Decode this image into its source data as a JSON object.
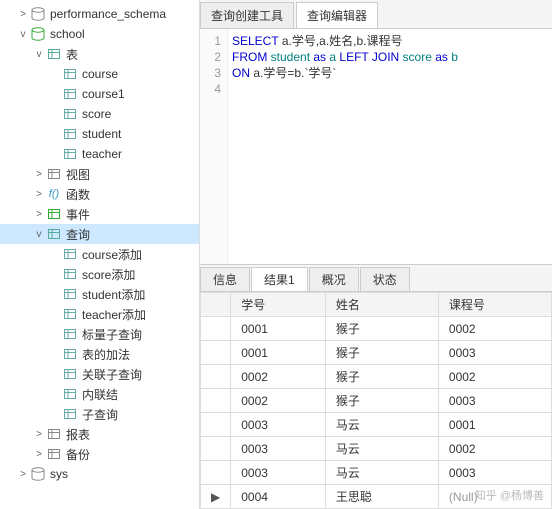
{
  "sidebar": {
    "nodes": [
      {
        "indent": 1,
        "expander": ">",
        "icon": "db",
        "label": "performance_schema",
        "name": "db-performance-schema",
        "interact": true
      },
      {
        "indent": 1,
        "expander": "v",
        "icon": "db-green",
        "label": "school",
        "name": "db-school",
        "interact": true
      },
      {
        "indent": 2,
        "expander": "v",
        "icon": "folder-table",
        "label": "表",
        "name": "folder-tables",
        "interact": true
      },
      {
        "indent": 3,
        "expander": "",
        "icon": "table",
        "label": "course",
        "name": "table-course",
        "interact": true
      },
      {
        "indent": 3,
        "expander": "",
        "icon": "table",
        "label": "course1",
        "name": "table-course1",
        "interact": true
      },
      {
        "indent": 3,
        "expander": "",
        "icon": "table",
        "label": "score",
        "name": "table-score",
        "interact": true
      },
      {
        "indent": 3,
        "expander": "",
        "icon": "table",
        "label": "student",
        "name": "table-student",
        "interact": true
      },
      {
        "indent": 3,
        "expander": "",
        "icon": "table",
        "label": "teacher",
        "name": "table-teacher",
        "interact": true
      },
      {
        "indent": 2,
        "expander": ">",
        "icon": "view",
        "label": "视图",
        "name": "folder-views",
        "interact": true
      },
      {
        "indent": 2,
        "expander": ">",
        "icon": "func",
        "label": "函数",
        "name": "folder-functions",
        "interact": true
      },
      {
        "indent": 2,
        "expander": ">",
        "icon": "event",
        "label": "事件",
        "name": "folder-events",
        "interact": true
      },
      {
        "indent": 2,
        "expander": "v",
        "icon": "query",
        "label": "查询",
        "name": "folder-queries",
        "interact": true,
        "selected": true
      },
      {
        "indent": 3,
        "expander": "",
        "icon": "sql",
        "label": "course添加",
        "name": "query-course-add",
        "interact": true
      },
      {
        "indent": 3,
        "expander": "",
        "icon": "sql",
        "label": "score添加",
        "name": "query-score-add",
        "interact": true
      },
      {
        "indent": 3,
        "expander": "",
        "icon": "sql",
        "label": "student添加",
        "name": "query-student-add",
        "interact": true
      },
      {
        "indent": 3,
        "expander": "",
        "icon": "sql",
        "label": "teacher添加",
        "name": "query-teacher-add",
        "interact": true
      },
      {
        "indent": 3,
        "expander": "",
        "icon": "sql",
        "label": "标量子查询",
        "name": "query-scalar-sub",
        "interact": true
      },
      {
        "indent": 3,
        "expander": "",
        "icon": "sql",
        "label": "表的加法",
        "name": "query-table-add",
        "interact": true
      },
      {
        "indent": 3,
        "expander": "",
        "icon": "sql",
        "label": "关联子查询",
        "name": "query-correlated-sub",
        "interact": true
      },
      {
        "indent": 3,
        "expander": "",
        "icon": "sql",
        "label": "内联结",
        "name": "query-inner-join",
        "interact": true
      },
      {
        "indent": 3,
        "expander": "",
        "icon": "sql",
        "label": "子查询",
        "name": "query-subquery",
        "interact": true
      },
      {
        "indent": 2,
        "expander": ">",
        "icon": "report",
        "label": "报表",
        "name": "folder-reports",
        "interact": true
      },
      {
        "indent": 2,
        "expander": ">",
        "icon": "backup",
        "label": "备份",
        "name": "folder-backup",
        "interact": true
      },
      {
        "indent": 1,
        "expander": ">",
        "icon": "db",
        "label": "sys",
        "name": "db-sys",
        "interact": true
      }
    ]
  },
  "topTabs": [
    {
      "label": "查询创建工具",
      "active": false
    },
    {
      "label": "查询编辑器",
      "active": true
    }
  ],
  "sql": {
    "lines": [
      "1",
      "2",
      "3",
      "4"
    ],
    "tokens": [
      [
        {
          "t": "SELECT ",
          "c": "kw"
        },
        {
          "t": "a.学号,a.姓名,b.课程号",
          "c": ""
        }
      ],
      [
        {
          "t": "FROM ",
          "c": "kw"
        },
        {
          "t": "student ",
          "c": "ident"
        },
        {
          "t": "as ",
          "c": "kw"
        },
        {
          "t": "a ",
          "c": "ident"
        },
        {
          "t": "LEFT JOIN ",
          "c": "kw"
        },
        {
          "t": "score ",
          "c": "ident"
        },
        {
          "t": "as ",
          "c": "kw"
        },
        {
          "t": "b",
          "c": "ident"
        }
      ],
      [
        {
          "t": "ON ",
          "c": "kw"
        },
        {
          "t": "a.学号=b.`学号`",
          "c": ""
        }
      ],
      [
        {
          "t": "",
          "c": ""
        }
      ]
    ]
  },
  "resultTabs": [
    {
      "label": "信息",
      "active": false
    },
    {
      "label": "结果1",
      "active": true
    },
    {
      "label": "概况",
      "active": false
    },
    {
      "label": "状态",
      "active": false
    }
  ],
  "grid": {
    "headers": [
      "学号",
      "姓名",
      "课程号"
    ],
    "rows": [
      {
        "ptr": "",
        "c": [
          "0001",
          "猴子",
          "0002"
        ]
      },
      {
        "ptr": "",
        "c": [
          "0001",
          "猴子",
          "0003"
        ]
      },
      {
        "ptr": "",
        "c": [
          "0002",
          "猴子",
          "0002"
        ]
      },
      {
        "ptr": "",
        "c": [
          "0002",
          "猴子",
          "0003"
        ]
      },
      {
        "ptr": "",
        "c": [
          "0003",
          "马云",
          "0001"
        ]
      },
      {
        "ptr": "",
        "c": [
          "0003",
          "马云",
          "0002"
        ]
      },
      {
        "ptr": "",
        "c": [
          "0003",
          "马云",
          "0003"
        ]
      },
      {
        "ptr": "▶",
        "c": [
          "0004",
          "王思聪",
          "(Null)"
        ],
        "null3": true
      }
    ]
  },
  "watermark": "知乎 @杨博善"
}
